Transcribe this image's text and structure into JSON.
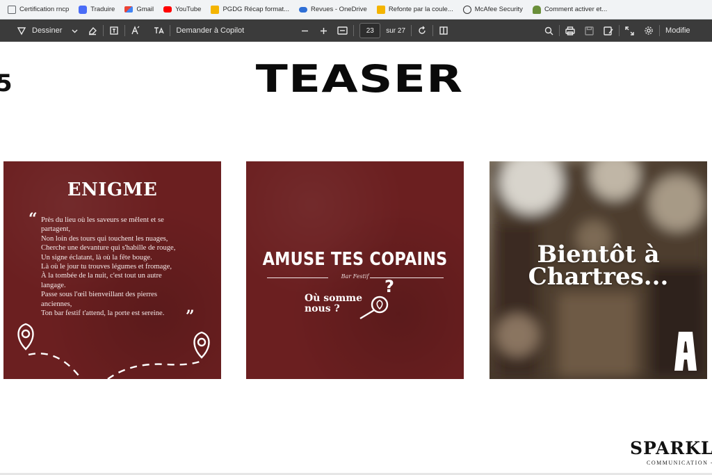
{
  "bookmarks": [
    {
      "label": "Certification rncp",
      "icon": "folder-icon",
      "color": "#5f6368"
    },
    {
      "label": "Traduire",
      "icon": "translate-icon",
      "color": "#4a6cf7"
    },
    {
      "label": "Gmail",
      "icon": "gmail-icon",
      "color": "#ea4335"
    },
    {
      "label": "YouTube",
      "icon": "youtube-icon",
      "color": "#ff0000"
    },
    {
      "label": "PGDG Récap format...",
      "icon": "folder-icon",
      "color": "#f4b400"
    },
    {
      "label": "Revues - OneDrive",
      "icon": "cloud-icon",
      "color": "#2f6fd6"
    },
    {
      "label": "Refonte par la coule...",
      "icon": "folder-icon",
      "color": "#f4b400"
    },
    {
      "label": "McAfee Security",
      "icon": "globe-icon",
      "color": "#333333"
    },
    {
      "label": "Comment activer et...",
      "icon": "android-icon",
      "color": "#6a8f3a"
    }
  ],
  "toolbar": {
    "draw_label": "Dessiner",
    "copilot_label": "Demander à Copilot",
    "page_current": "23",
    "page_total": "sur 27",
    "modify_label": "Modifie"
  },
  "slide": {
    "number": "5",
    "title": "TEASER"
  },
  "card1": {
    "title": "ENIGME",
    "open_quote": "“",
    "close_quote": "”",
    "lines": [
      "Près du lieu où les saveurs se mêlent et se",
      "partagent,",
      "Non loin des tours qui touchent les nuages,",
      "Cherche une devanture qui s'habille de rouge,",
      "Un signe éclatant, là où la fête bouge.",
      "Là où le jour tu trouves légumes et fromage,",
      "À la tombée de la nuit, c'est tout un autre",
      "langage.",
      "Passe sous l'œil bienveillant des pierres",
      "anciennes,",
      "Ton bar festif t'attend, la porte est sereine."
    ]
  },
  "card2": {
    "headline": "AMUSE TES COPAINS",
    "tagline": "Bar Festif",
    "question_line1": "Où somme",
    "question_line2": "nous ?",
    "question_mark": "?"
  },
  "card3": {
    "line1": "Bientôt à",
    "line2": "Chartres..."
  },
  "brand": {
    "name": "SPARKLE",
    "subtitle": "COMMUNICATION - EV"
  },
  "colors": {
    "card_red": "#6b1f20",
    "toolbar_bg": "#3b3b3b",
    "bookmarks_bg": "#f1f3f5"
  }
}
